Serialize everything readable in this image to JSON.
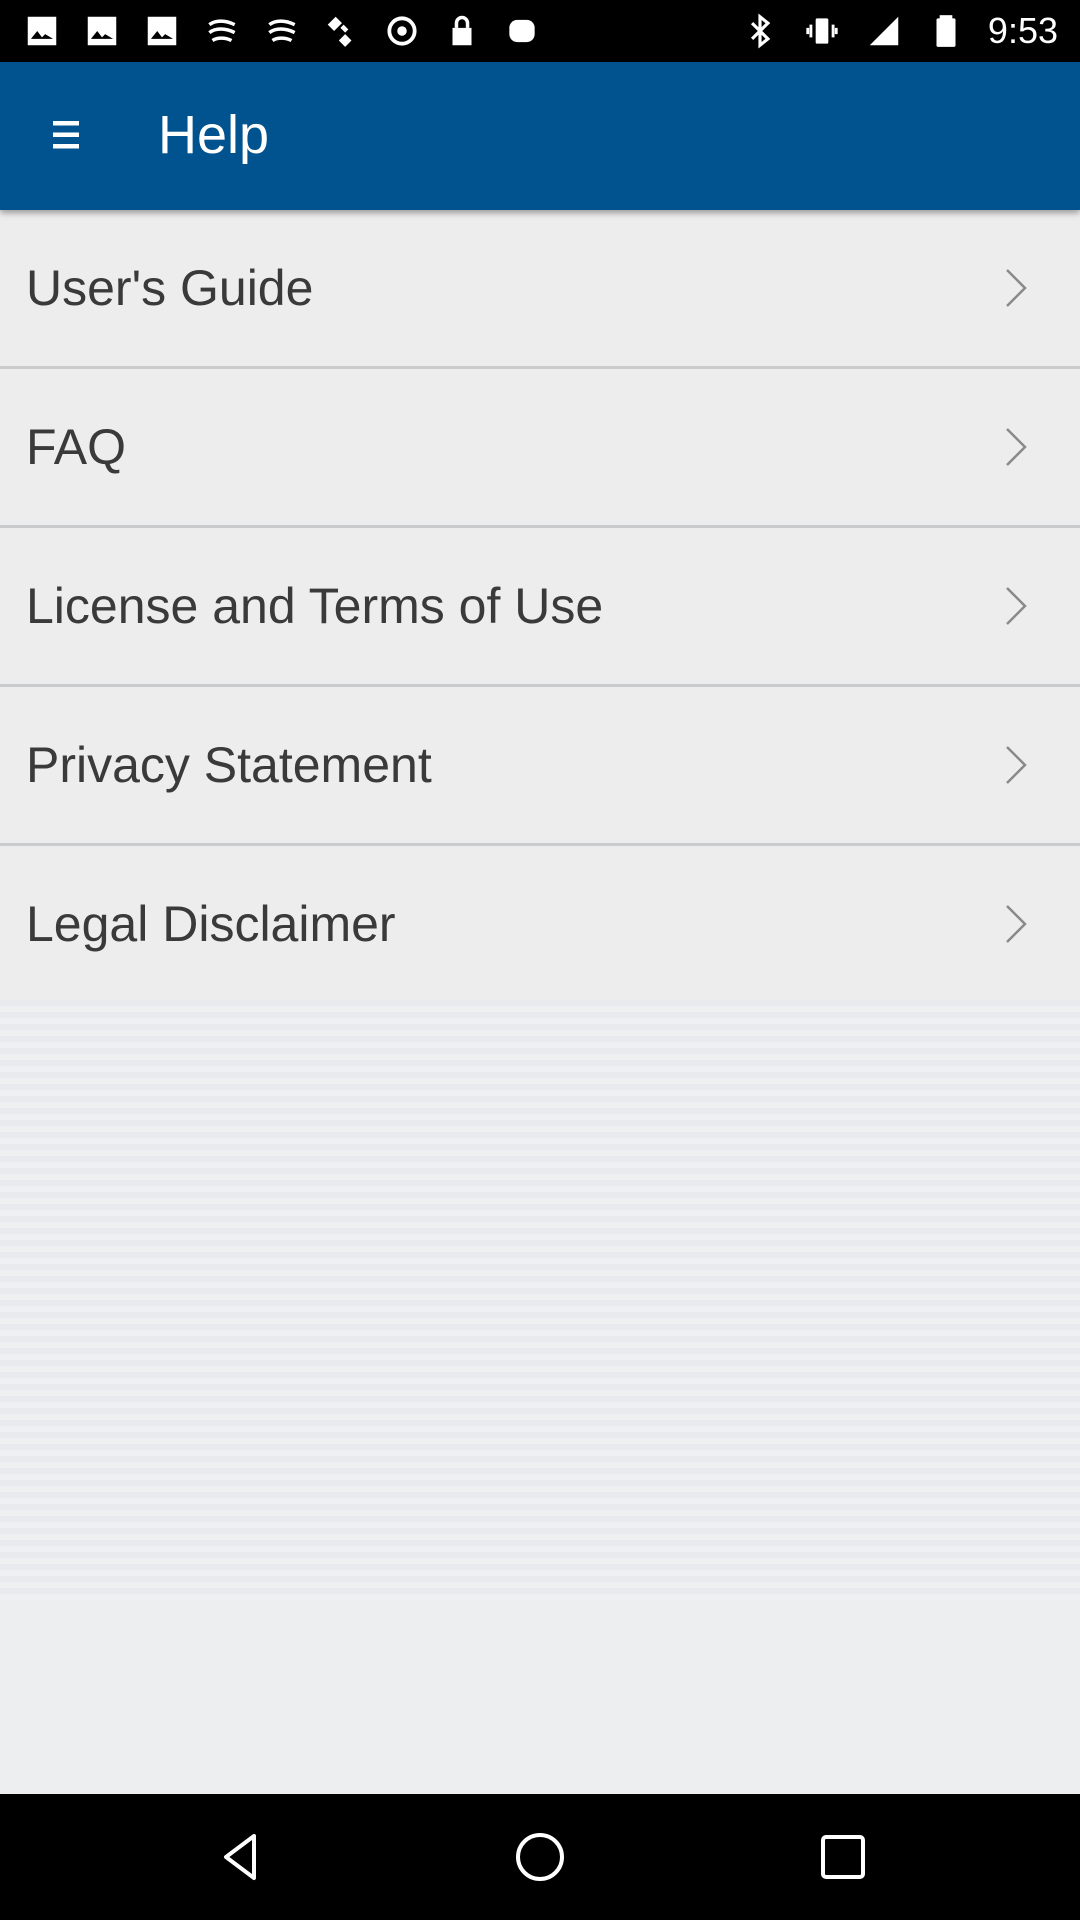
{
  "status_bar": {
    "time": "9:53",
    "left_icons": [
      "photo-icon",
      "photo-icon",
      "photo-icon",
      "fan-icon",
      "fan-icon",
      "satellite-icon",
      "circle-icon",
      "lock-icon",
      "android-icon"
    ],
    "right_icons": [
      "bluetooth-icon",
      "vibrate-icon",
      "signal-icon",
      "battery-icon"
    ]
  },
  "app_bar": {
    "title": "Help",
    "background": "#01538f",
    "menu_icon": "hamburger-icon"
  },
  "list": {
    "items": [
      {
        "label": "User's Guide",
        "icon": "chevron-right-icon"
      },
      {
        "label": "FAQ",
        "icon": "chevron-right-icon"
      },
      {
        "label": "License and Terms of Use",
        "icon": "chevron-right-icon"
      },
      {
        "label": "Privacy Statement",
        "icon": "chevron-right-icon"
      },
      {
        "label": "Legal Disclaimer",
        "icon": "chevron-right-icon"
      }
    ]
  },
  "nav_bar": {
    "buttons": [
      "back-icon",
      "home-icon",
      "recents-icon"
    ]
  }
}
